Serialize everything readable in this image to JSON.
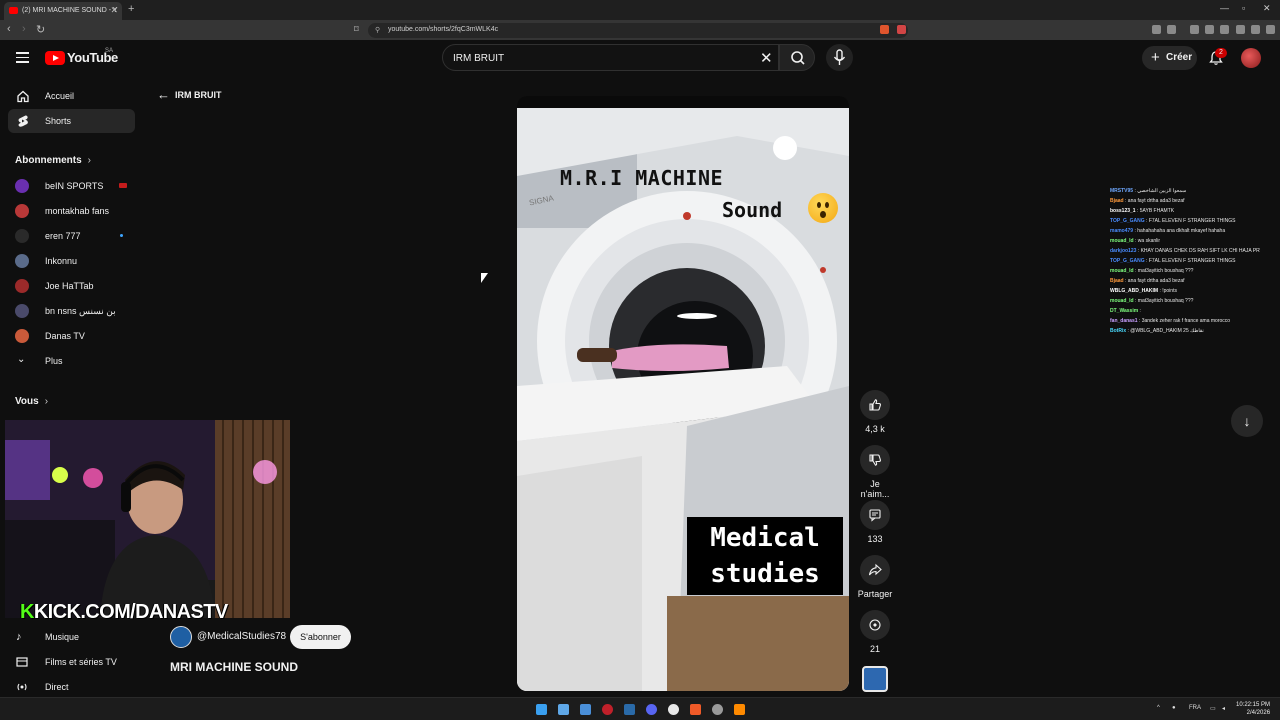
{
  "browser": {
    "tab_title": "(2) MRI MACHINE SOUND - Y",
    "url": "youtube.com/shorts/2fqC3mWLK4c"
  },
  "header": {
    "logo_text": "YouTube",
    "country_code": "SA",
    "search_value": "IRM BRUIT",
    "create_label": "Créer",
    "notification_count": "2"
  },
  "sidebar": {
    "home": "Accueil",
    "shorts": "Shorts",
    "subscriptions_heading": "Abonnements",
    "subscriptions": [
      {
        "name": "beIN SPORTS",
        "color": "#6a2fb0"
      },
      {
        "name": "montakhab fans",
        "color": "#b83838"
      },
      {
        "name": "eren 777",
        "color": "#2a2a2a"
      },
      {
        "name": "Inkonnu",
        "color": "#5a6b8a"
      },
      {
        "name": "Joe HaTTab",
        "color": "#9b2a2a"
      },
      {
        "name": "bn nsns بن نسنس",
        "color": "#4a4a6a"
      },
      {
        "name": "Danas TV",
        "color": "#c95a3a"
      }
    ],
    "more": "Plus",
    "you_heading": "Vous",
    "music": "Musique",
    "movies": "Films et séries TV",
    "live": "Direct"
  },
  "overlay": {
    "kick_logo": "K",
    "kick_text": "KICK.COM/DANASTV"
  },
  "shorts": {
    "back_query": "IRM BRUIT",
    "video_text_1": "M.R.I MACHINE",
    "video_text_2": "Sound",
    "brand_text": "SIGNA",
    "caption_line1": "Medical",
    "caption_line2": "studies",
    "channel_handle": "@MedicalStudies78",
    "subscribe_label": "S'abonner",
    "video_title": "MRI MACHINE SOUND",
    "likes": "4,3 k",
    "dislike_label": "Je n'aim...",
    "comments": "133",
    "share_label": "Partager",
    "remix_count": "21"
  },
  "chat": [
    {
      "user": "MRSTV95",
      "text": "سمعوا الزبين الشاخصي",
      "color": "#6fa8ff"
    },
    {
      "user": "Bjaad",
      "text": "ana fayt drtha ada3 bezaf",
      "color": "#ff9a3c"
    },
    {
      "user": "boss123_1",
      "text": "5AYB FHAMTK",
      "color": "#ffffff"
    },
    {
      "user": "TOP_G_GANG",
      "text": "F7AL ELEVEN F STRANGER THINGS",
      "color": "#4a8cff"
    },
    {
      "user": "mamo479",
      "text": "hahahahaha ana dkhalt mkayef hahaha",
      "color": "#4a8cff"
    },
    {
      "user": "mouad_ld",
      "text": "wa skanlir",
      "color": "#7fff7f"
    },
    {
      "user": "darkjoo123",
      "text": "KHAY DANAS CHEK DS RAH SIFT LK CHI HAJA PRV CHOFHA DRR",
      "color": "#4a8cff"
    },
    {
      "user": "TOP_G_GANG",
      "text": "F7AL ELEVEN F STRANGER THINGS",
      "color": "#4a8cff"
    },
    {
      "user": "mouad_ld",
      "text": "mat3ayitich boushaq ???",
      "color": "#7fff7f"
    },
    {
      "user": "Bjaad",
      "text": "ana fayt drtha ada3 bezaf",
      "color": "#ff9a3c"
    },
    {
      "user": "WBLG_ABD_HAKIM",
      "text": "!points",
      "color": "#ffffff"
    },
    {
      "user": "mouad_ld",
      "text": "mat3ayitich boushaq ???",
      "color": "#7fff7f"
    },
    {
      "user": "DT_Wassim",
      "text": "",
      "color": "#7fff7f"
    },
    {
      "user": "fan_danas1",
      "text": "3andek zeher rak f france ama morocco",
      "color": "#c9a0ff"
    },
    {
      "user": "BotRix",
      "text": "@WBLG_ABD_HAKIM نقاطك 25",
      "color": "#4adbff"
    }
  ],
  "taskbar": {
    "lang": "FRA",
    "time": "10:22:15 PM",
    "date": "2/4/2026"
  }
}
